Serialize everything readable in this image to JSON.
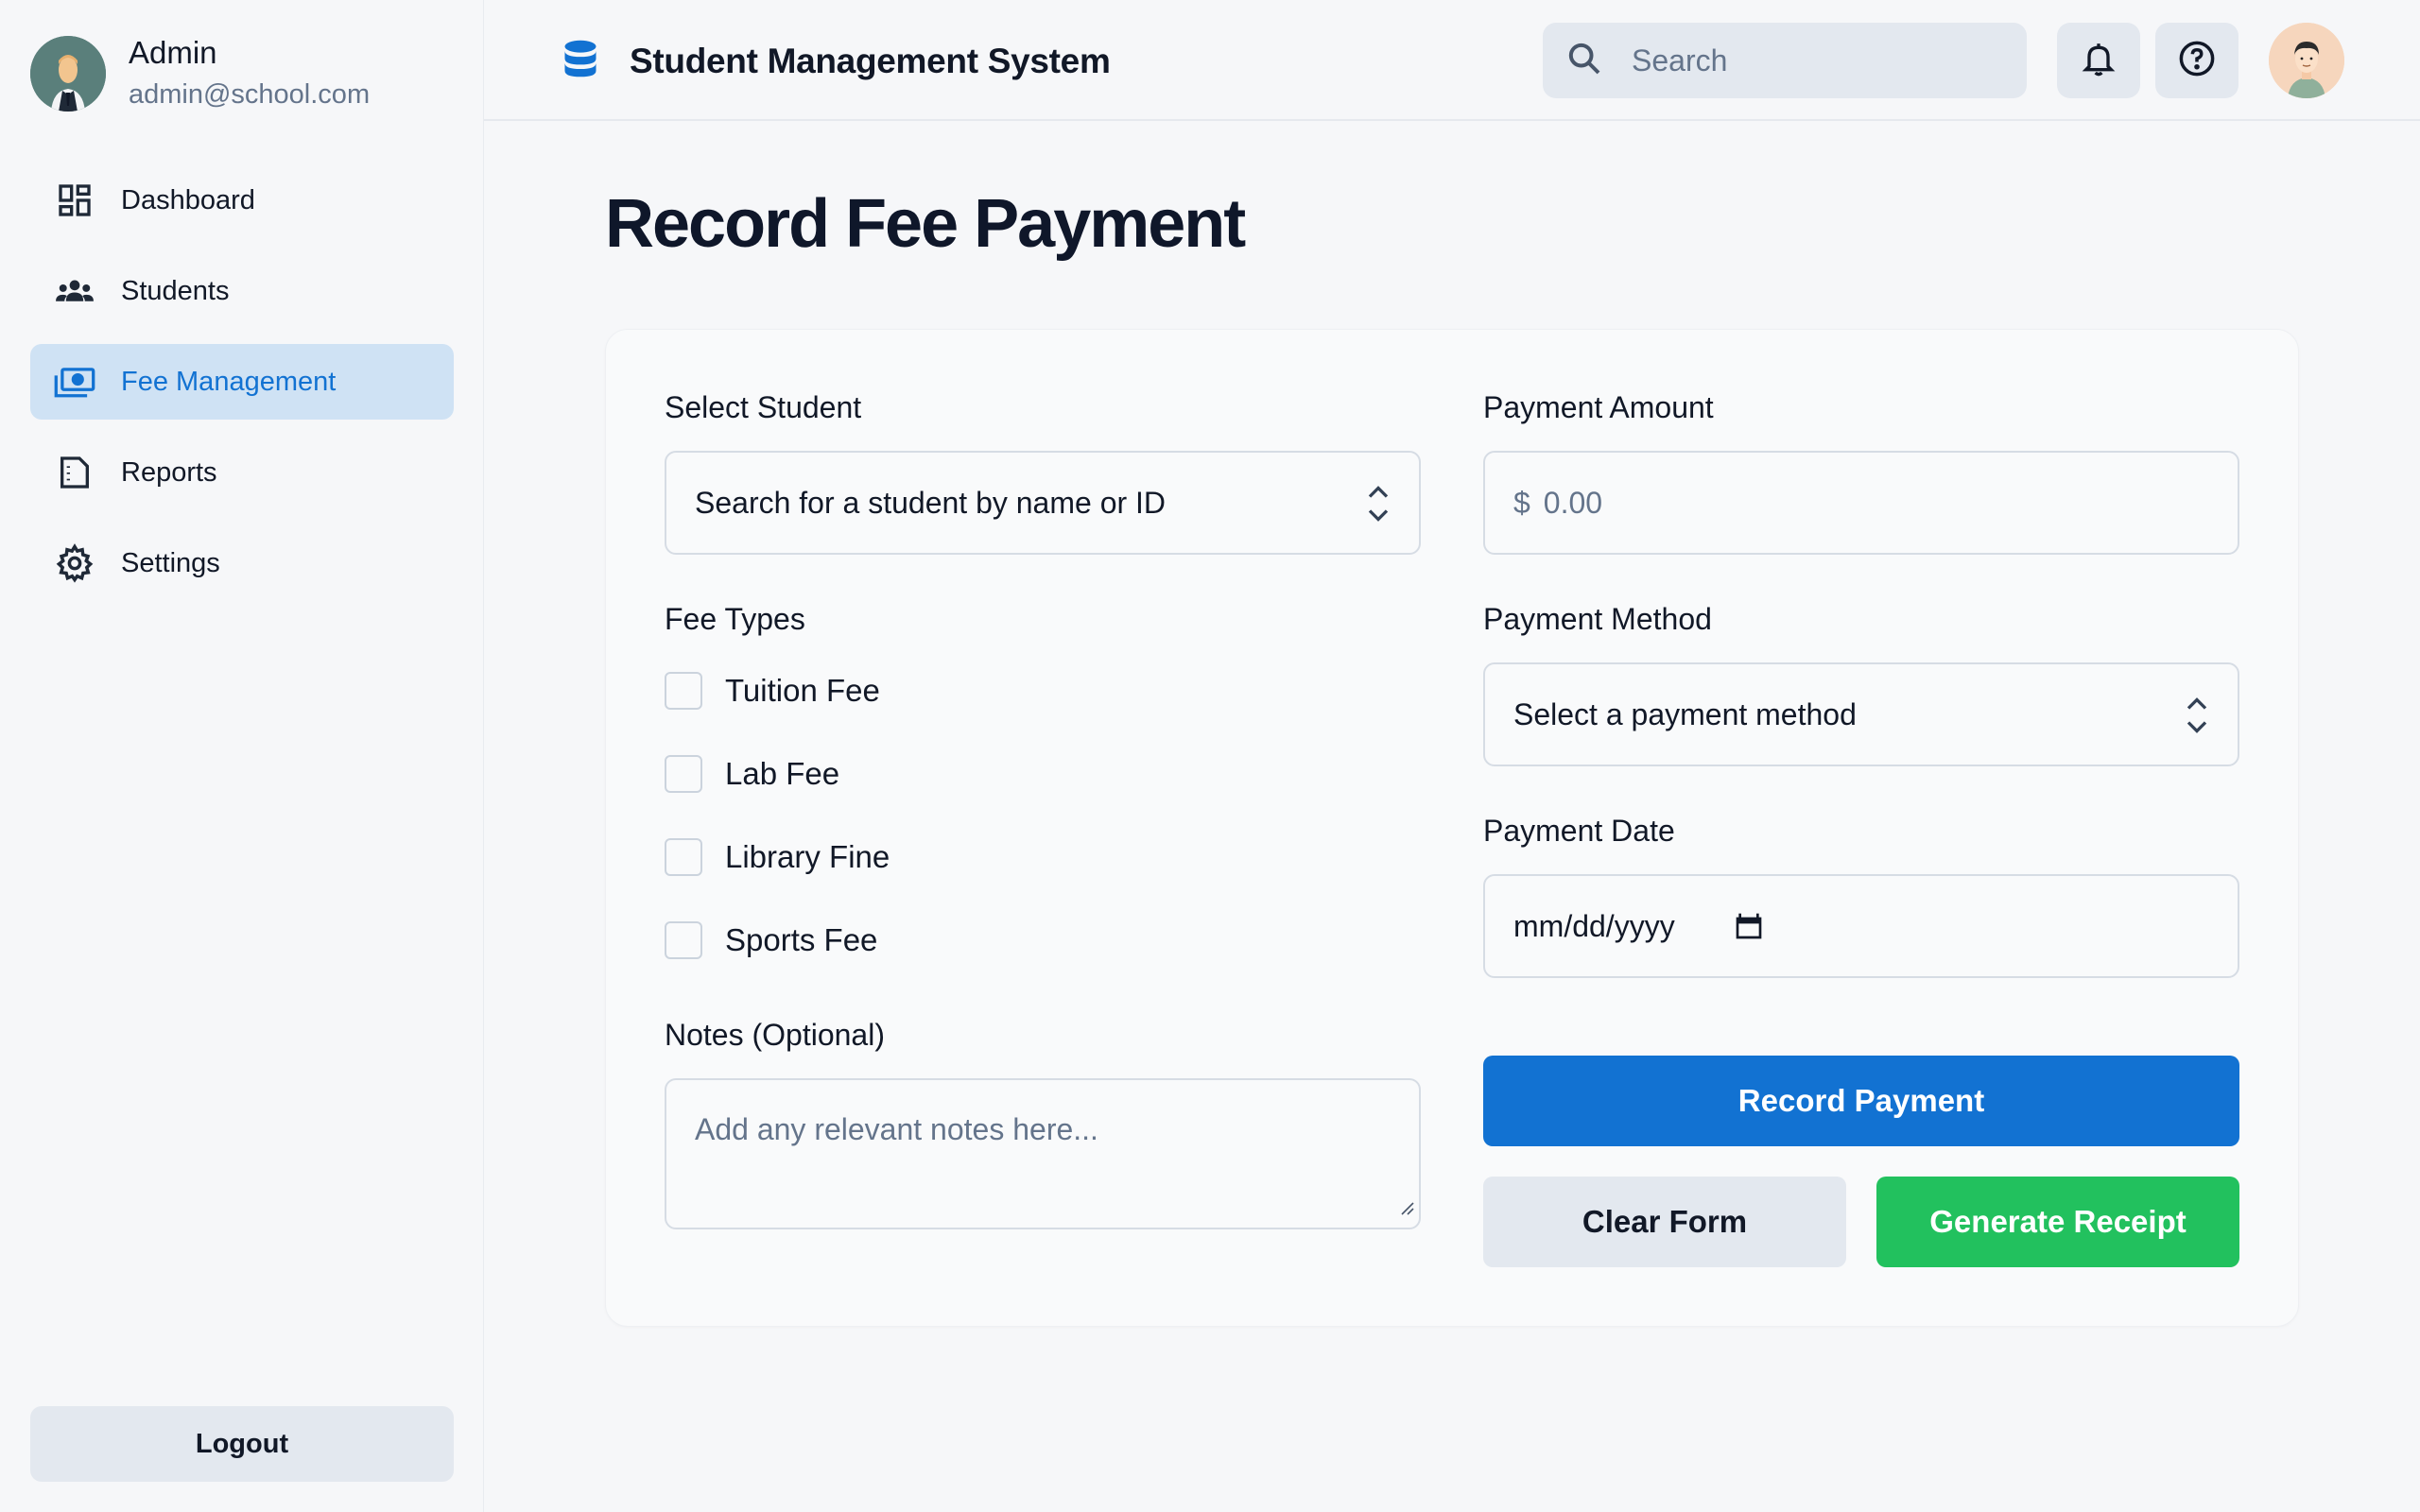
{
  "user": {
    "name": "Admin",
    "email": "admin@school.com"
  },
  "sidebar": {
    "items": [
      {
        "label": "Dashboard",
        "icon": "dashboard-icon"
      },
      {
        "label": "Students",
        "icon": "students-icon"
      },
      {
        "label": "Fee Management",
        "icon": "payments-icon",
        "active": true
      },
      {
        "label": "Reports",
        "icon": "reports-icon"
      },
      {
        "label": "Settings",
        "icon": "gear-icon"
      }
    ],
    "logout_label": "Logout"
  },
  "header": {
    "app_title": "Student Management System",
    "search_placeholder": "Search"
  },
  "main": {
    "page_title": "Record Fee Payment",
    "select_student": {
      "label": "Select Student",
      "placeholder": "Search for a student by name or ID"
    },
    "fee_types": {
      "label": "Fee Types",
      "options": [
        "Tuition Fee",
        "Lab Fee",
        "Library Fine",
        "Sports Fee"
      ]
    },
    "notes": {
      "label": "Notes (Optional)",
      "placeholder": "Add any relevant notes here..."
    },
    "payment_amount": {
      "label": "Payment Amount",
      "currency": "$",
      "placeholder": "0.00"
    },
    "payment_method": {
      "label": "Payment Method",
      "placeholder": "Select a payment method"
    },
    "payment_date": {
      "label": "Payment Date",
      "placeholder": "mm/dd/yyyy"
    },
    "buttons": {
      "record": "Record Payment",
      "clear": "Clear Form",
      "receipt": "Generate Receipt"
    }
  },
  "colors": {
    "primary": "#1272d2",
    "success": "#22c15e",
    "active_nav_bg": "#cfe2f4"
  }
}
